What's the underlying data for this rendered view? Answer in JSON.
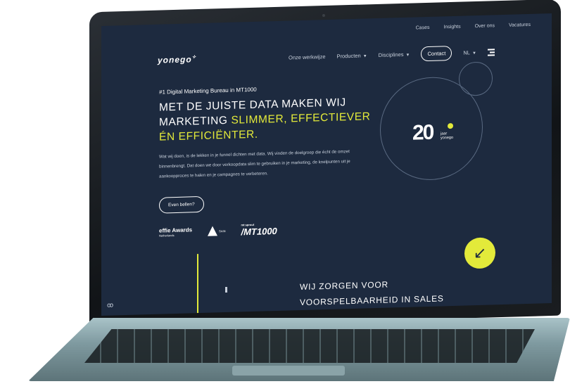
{
  "nav": {
    "top_links": [
      "Cases",
      "Insights",
      "Over ons",
      "Vacatures"
    ],
    "logo": "yonego",
    "main_links": [
      {
        "label": "Onze werkwijze",
        "dropdown": false
      },
      {
        "label": "Producten",
        "dropdown": true
      },
      {
        "label": "Disciplines",
        "dropdown": true
      }
    ],
    "contact_label": "Contact",
    "language": "NL"
  },
  "hero": {
    "eyebrow": "#1 Digital Marketing Bureau in MT1000",
    "headline_line1": "MET DE JUISTE DATA MAKEN WIJ",
    "headline_line2_plain": "MARKETING ",
    "headline_line2_highlight": "SLIMMER, EFFECTIEVER",
    "headline_line3_highlight": "ÉN EFFICIËNTER.",
    "body": "Wat wij doen, is de lekken in je funnel dichten met data. Wij vinden de doelgroep die écht de omzet binnenbrengt. Dat doen we door verkoopdata slim te gebruiken in je marketing, de knelpunten uit je aankoopproces te halen en je campagnes te verbeteren.",
    "cta_label": "Even bellen?"
  },
  "awards": {
    "effie": "effie Awards",
    "effie_sub": "Netherlands",
    "sain": "SAIN",
    "mt_sub": "mt:sprout",
    "mt": "/MT1000"
  },
  "badge": {
    "number": "20",
    "label_line1": "jaar",
    "label_line2": "yonego"
  },
  "section2": {
    "line1": "WIJ ZORGEN VOOR",
    "line2": "VOORSPELBAARHEID IN SALES"
  },
  "colors": {
    "background": "#1d2a3f",
    "accent": "#e3ea3a",
    "text": "#ffffff"
  },
  "icons": {
    "down_arrow": "↙",
    "cookie": "cookie-icon"
  }
}
